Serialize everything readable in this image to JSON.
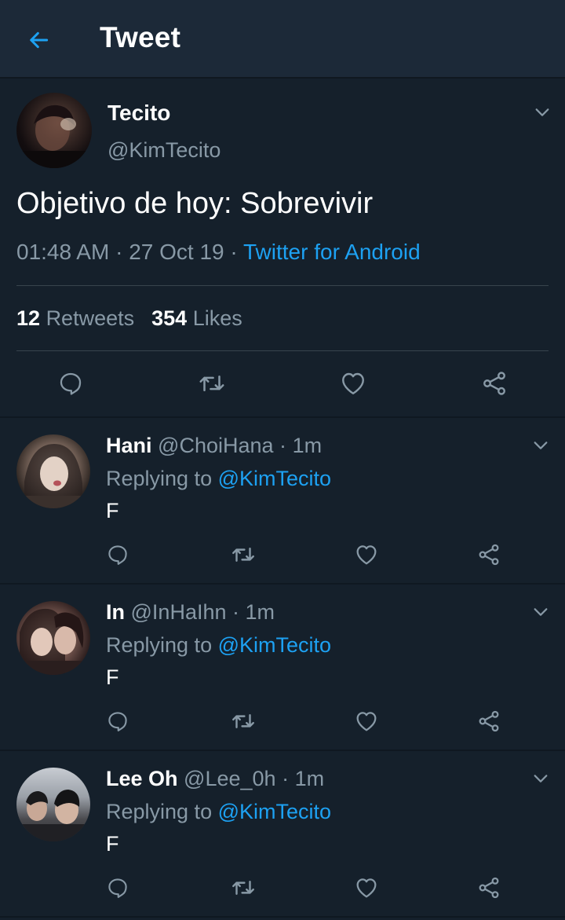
{
  "header": {
    "title": "Tweet"
  },
  "tweet": {
    "name": "Tecito",
    "handle": "@KimTecito",
    "text": "Objetivo de hoy: Sobrevivir",
    "time": "01:48 AM",
    "date": "27 Oct 19",
    "separator": "·",
    "source": "Twitter for Android",
    "retweets_count": "12",
    "retweets_label": "Retweets",
    "likes_count": "354",
    "likes_label": "Likes"
  },
  "replies": [
    {
      "name": "Hani",
      "handle": "@ChoiHana",
      "time": "1m",
      "replying_prefix": "Replying to",
      "replying_to": "@KimTecito",
      "text": "F"
    },
    {
      "name": "In",
      "handle": "@InHaIhn",
      "time": "1m",
      "replying_prefix": "Replying to",
      "replying_to": "@KimTecito",
      "text": "F"
    },
    {
      "name": "Lee Oh",
      "handle": "@Lee_0h",
      "time": "1m",
      "replying_prefix": "Replying to",
      "replying_to": "@KimTecito",
      "text": "F"
    }
  ],
  "icons": [
    "back-arrow-icon",
    "chevron-down-icon",
    "reply-icon",
    "retweet-icon",
    "like-icon",
    "share-icon"
  ],
  "colors": {
    "background": "#15202b",
    "header": "#1c2938",
    "accent": "#1da1f2",
    "secondary_text": "#8899a6",
    "icon": "#8899a6"
  }
}
